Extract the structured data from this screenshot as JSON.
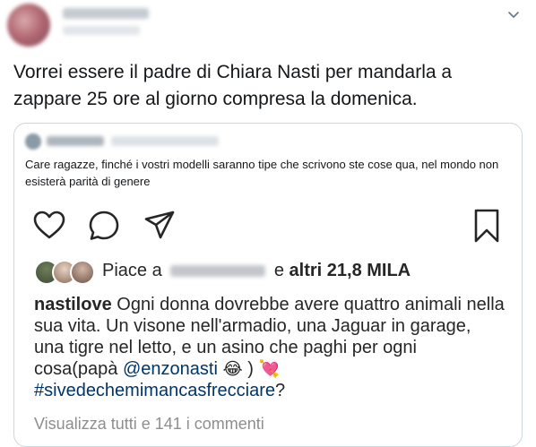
{
  "tweet": {
    "text": "Vorrei essere il padre di Chiara Nasti per mandarla a zappare 25 ore al giorno compresa la domenica."
  },
  "quote": {
    "text": "Care ragazze, finché i vostri modelli saranno tipe che scrivono ste cose qua, nel mondo non esisterà parità di genere"
  },
  "instagram": {
    "likes_prefix": "Piace a",
    "likes_suffix_plain": "e",
    "likes_suffix_bold": "altri 21,8 MILA",
    "caption_user": "nastilove",
    "caption_text": "Ogni donna dovrebbe avere quattro animali nella sua vita. Un visone nell'armadio, una Jaguar in garage, una tigre nel letto, e un asino che paghi per ogni cosa(papà",
    "caption_mention": "@enzonasti",
    "caption_emoji1": "😂",
    "caption_close": ")",
    "caption_emoji2": "💘",
    "caption_hashtag": "#sivedechemimancasfrecciare",
    "caption_end": "?",
    "view_all": "Visualizza tutti e 141 i commenti"
  },
  "colors": {
    "text": "#14171a",
    "border": "#ccd6dd",
    "ig_link": "#003569",
    "muted": "#8e8e8e"
  },
  "icons": {
    "chevron": "chevron-down-icon",
    "heart": "heart-icon",
    "comment": "comment-icon",
    "share": "paper-plane-icon",
    "bookmark": "bookmark-icon"
  }
}
